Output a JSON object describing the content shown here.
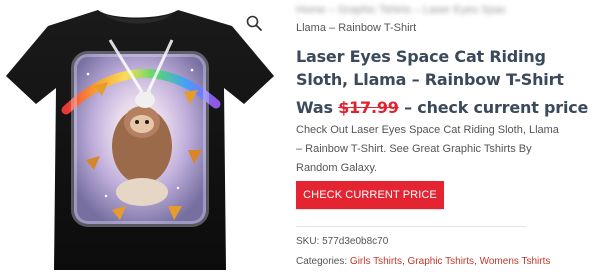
{
  "product_image": {
    "alt": "Black t-shirt with laser eyes space cat riding sloth and llama over a rainbow galaxy"
  },
  "zoom": {
    "icon": "magnifier-icon"
  },
  "breadcrumb_blurred": "Home – Graphic Tshirts – Laser Eyes Space Cat",
  "breadcrumb": "Llama – Rainbow T-Shirt",
  "title": "Laser Eyes Space Cat Riding Sloth, Llama – Rainbow T-Shirt",
  "price": {
    "prefix": "Was",
    "old": "$17.99",
    "suffix": "– check current price"
  },
  "description": "Check Out Laser Eyes Space Cat Riding Sloth, Llama – Rainbow T-Shirt. See Great Graphic Tshirts By Random Galaxy.",
  "button_label": "CHECK CURRENT PRICE",
  "sku": {
    "label": "SKU:",
    "value": "577d3e0b8c70"
  },
  "categories": {
    "label": "Categories:",
    "items": [
      "Girls Tshirts",
      "Graphic Tshirts",
      "Womens Tshirts"
    ]
  },
  "colors": {
    "accent": "#e52431",
    "title": "#3b4a5b",
    "link": "#c0392b"
  }
}
